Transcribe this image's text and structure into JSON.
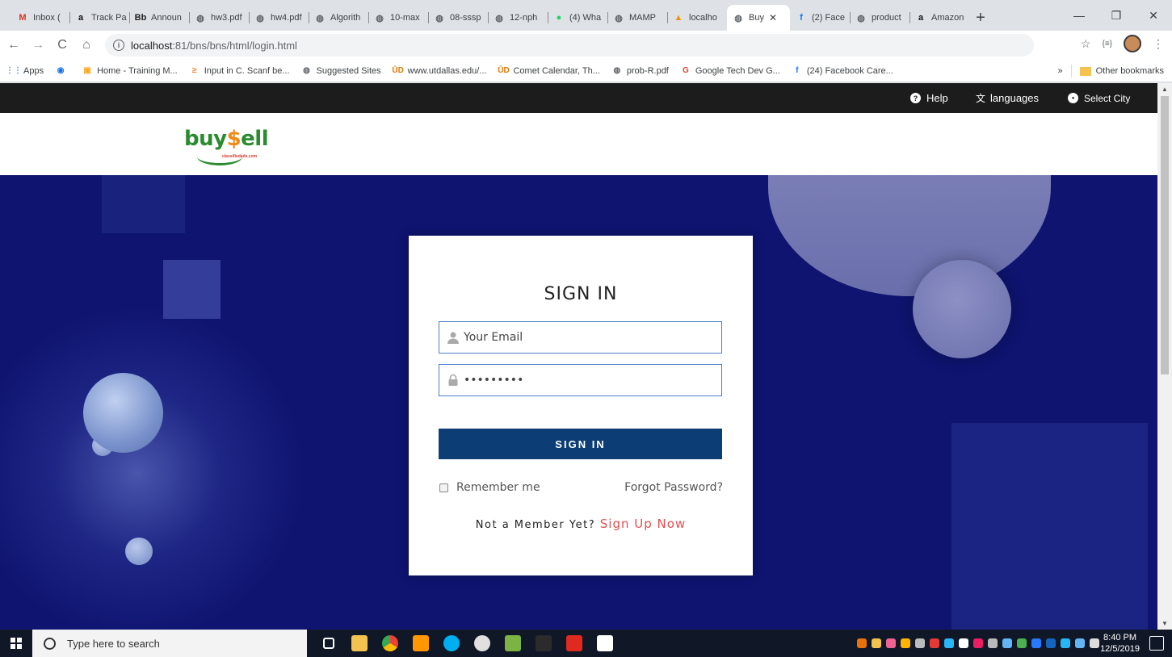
{
  "browser": {
    "tabs": [
      {
        "label": "Inbox (",
        "icon": "gmail-icon",
        "color": "#d93025",
        "glyph": "M"
      },
      {
        "label": "Track Pa",
        "icon": "amazon-icon",
        "color": "#111",
        "glyph": "a"
      },
      {
        "label": "Announ",
        "icon": "blackboard-icon",
        "color": "#222",
        "glyph": "Bb"
      },
      {
        "label": "hw3.pdf",
        "icon": "globe-icon",
        "color": "#5f6368",
        "glyph": "◍"
      },
      {
        "label": "hw4.pdf",
        "icon": "globe-icon",
        "color": "#5f6368",
        "glyph": "◍"
      },
      {
        "label": "Algorith",
        "icon": "globe-icon",
        "color": "#5f6368",
        "glyph": "◍"
      },
      {
        "label": "10-max",
        "icon": "globe-icon",
        "color": "#5f6368",
        "glyph": "◍"
      },
      {
        "label": "08-sssp",
        "icon": "globe-icon",
        "color": "#5f6368",
        "glyph": "◍"
      },
      {
        "label": "12-nph",
        "icon": "globe-icon",
        "color": "#5f6368",
        "glyph": "◍"
      },
      {
        "label": "(4) Wha",
        "icon": "whatsapp-icon",
        "color": "#25d366",
        "glyph": "●"
      },
      {
        "label": "MAMP",
        "icon": "globe-icon",
        "color": "#5f6368",
        "glyph": "◍"
      },
      {
        "label": "localho",
        "icon": "phpmyadmin-icon",
        "color": "#f29111",
        "glyph": "▲"
      },
      {
        "label": "Buy",
        "icon": "globe-icon",
        "color": "#5f6368",
        "glyph": "◍",
        "active": true
      },
      {
        "label": "(2) Face",
        "icon": "facebook-icon",
        "color": "#1877f2",
        "glyph": "f"
      },
      {
        "label": "product",
        "icon": "globe-icon",
        "color": "#5f6368",
        "glyph": "◍"
      },
      {
        "label": "Amazon",
        "icon": "amazon-icon",
        "color": "#111",
        "glyph": "a"
      }
    ],
    "tab_close_glyph": "✕",
    "new_tab_glyph": "+",
    "window_controls": {
      "minimize": "—",
      "restore": "❐",
      "close": "✕"
    },
    "url_host": "localhost",
    "url_path": ":81/bns/bns/html/login.html",
    "nav": {
      "back": "←",
      "forward": "→",
      "reload": "C",
      "home": "⌂"
    },
    "info_glyph": "i",
    "toolbar_right": {
      "star": "☆",
      "ext": "{≡}",
      "menu": "⋮"
    },
    "bookmarks": [
      {
        "label": "Apps",
        "icon": "apps-grid-icon",
        "color": "#4285f4",
        "glyph": "⋮⋮"
      },
      {
        "label": "",
        "icon": "firefox-icon",
        "color": "#1a73e8",
        "glyph": "◉"
      },
      {
        "label": "Home - Training M...",
        "icon": "bookmark-orange-icon",
        "color": "#f9a825",
        "glyph": "▣"
      },
      {
        "label": "Input in C. Scanf be...",
        "icon": "stack-icon",
        "color": "#f48024",
        "glyph": "≥"
      },
      {
        "label": "Suggested Sites",
        "icon": "globe-icon",
        "color": "#5f6368",
        "glyph": "◍"
      },
      {
        "label": "www.utdallas.edu/...",
        "icon": "utd-icon",
        "color": "#e87500",
        "glyph": "ŪD"
      },
      {
        "label": "Comet Calendar, Th...",
        "icon": "utd-icon",
        "color": "#e87500",
        "glyph": "ŪD"
      },
      {
        "label": "prob-R.pdf",
        "icon": "globe-icon",
        "color": "#5f6368",
        "glyph": "◍"
      },
      {
        "label": "Google Tech Dev G...",
        "icon": "google-icon",
        "color": "#ea4335",
        "glyph": "G"
      },
      {
        "label": "(24) Facebook Care...",
        "icon": "facebook-icon",
        "color": "#1877f2",
        "glyph": "f"
      }
    ],
    "bookmarks_more": "»",
    "other_bookmarks": "Other bookmarks"
  },
  "site": {
    "topbar": {
      "help": "Help",
      "languages": "languages",
      "select_city": "Select City",
      "help_glyph": "?",
      "languages_glyph": "文",
      "city_glyph": "●"
    },
    "logo": {
      "buy": "buy",
      "dollar": "$",
      "sell": "ell",
      "sub": "classifiedads.com"
    },
    "login": {
      "title": "SIGN IN",
      "email_placeholder": "Your Email",
      "password_value": "secret123",
      "user_glyph": "👤",
      "lock_glyph": "🔒",
      "button": "SIGN IN",
      "remember": "Remember me",
      "forgot": "Forgot Password?",
      "not_member": "Not a Member Yet?",
      "signup": "Sign Up Now"
    },
    "colors": {
      "hero_bg": "#0e1470",
      "button_bg": "#0c3d74",
      "signup_link": "#e94e4e",
      "topbar_bg": "#1c1c1c"
    }
  },
  "taskbar": {
    "search_placeholder": "Type here to search",
    "apps": [
      {
        "icon": "task-view-icon",
        "color": "#101828"
      },
      {
        "icon": "file-explorer-icon",
        "color": "#f3c24f"
      },
      {
        "icon": "chrome-icon",
        "color": "#e8a419"
      },
      {
        "icon": "sublime-icon",
        "color": "#ff9800"
      },
      {
        "icon": "skype-icon",
        "color": "#00aff0"
      },
      {
        "icon": "github-icon",
        "color": "#e0e0e0"
      },
      {
        "icon": "notepad-icon",
        "color": "#7cb342"
      },
      {
        "icon": "terminal-icon",
        "color": "#2b2b2b"
      },
      {
        "icon": "acrobat-icon",
        "color": "#e02a20"
      },
      {
        "icon": "photos-icon",
        "color": "#ffffff"
      }
    ],
    "tray_colors": [
      "#e8710a",
      "#f3c24f",
      "#f06292",
      "#ffb300",
      "#bbbbbb",
      "#e53935",
      "#29b6f6",
      "#ffffff",
      "#e91e63",
      "#bbbbbb",
      "#64b5f6",
      "#4caf50",
      "#2979ff",
      "#1565c0",
      "#29b6f6",
      "#64b5f6",
      "#dddddd"
    ],
    "time": "8:40 PM",
    "date": "12/5/2019"
  }
}
